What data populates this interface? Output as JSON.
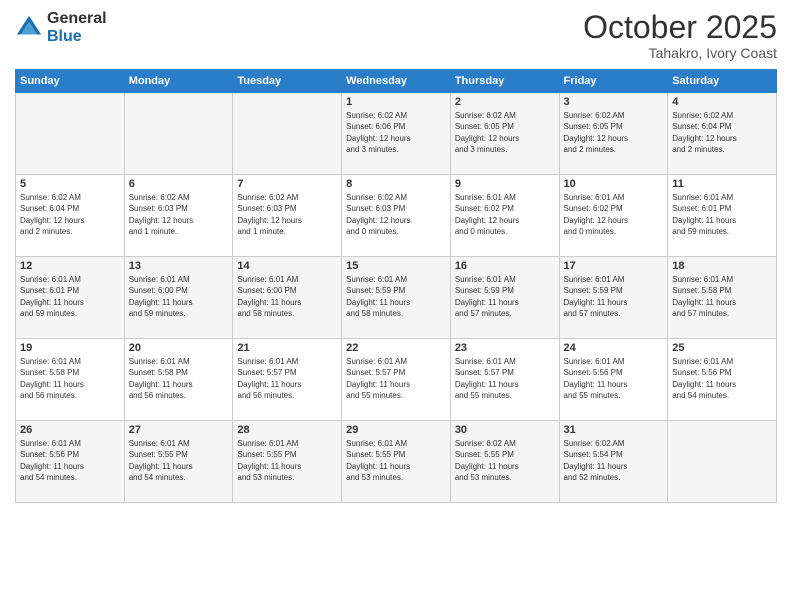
{
  "header": {
    "logo_general": "General",
    "logo_blue": "Blue",
    "month": "October 2025",
    "location": "Tahakro, Ivory Coast"
  },
  "weekdays": [
    "Sunday",
    "Monday",
    "Tuesday",
    "Wednesday",
    "Thursday",
    "Friday",
    "Saturday"
  ],
  "weeks": [
    [
      {
        "day": "",
        "detail": ""
      },
      {
        "day": "",
        "detail": ""
      },
      {
        "day": "",
        "detail": ""
      },
      {
        "day": "1",
        "detail": "Sunrise: 6:02 AM\nSunset: 6:06 PM\nDaylight: 12 hours\nand 3 minutes."
      },
      {
        "day": "2",
        "detail": "Sunrise: 6:02 AM\nSunset: 6:05 PM\nDaylight: 12 hours\nand 3 minutes."
      },
      {
        "day": "3",
        "detail": "Sunrise: 6:02 AM\nSunset: 6:05 PM\nDaylight: 12 hours\nand 2 minutes."
      },
      {
        "day": "4",
        "detail": "Sunrise: 6:02 AM\nSunset: 6:04 PM\nDaylight: 12 hours\nand 2 minutes."
      }
    ],
    [
      {
        "day": "5",
        "detail": "Sunrise: 6:02 AM\nSunset: 6:04 PM\nDaylight: 12 hours\nand 2 minutes."
      },
      {
        "day": "6",
        "detail": "Sunrise: 6:02 AM\nSunset: 6:03 PM\nDaylight: 12 hours\nand 1 minute."
      },
      {
        "day": "7",
        "detail": "Sunrise: 6:02 AM\nSunset: 6:03 PM\nDaylight: 12 hours\nand 1 minute."
      },
      {
        "day": "8",
        "detail": "Sunrise: 6:02 AM\nSunset: 6:03 PM\nDaylight: 12 hours\nand 0 minutes."
      },
      {
        "day": "9",
        "detail": "Sunrise: 6:01 AM\nSunset: 6:02 PM\nDaylight: 12 hours\nand 0 minutes."
      },
      {
        "day": "10",
        "detail": "Sunrise: 6:01 AM\nSunset: 6:02 PM\nDaylight: 12 hours\nand 0 minutes."
      },
      {
        "day": "11",
        "detail": "Sunrise: 6:01 AM\nSunset: 6:01 PM\nDaylight: 11 hours\nand 59 minutes."
      }
    ],
    [
      {
        "day": "12",
        "detail": "Sunrise: 6:01 AM\nSunset: 6:01 PM\nDaylight: 11 hours\nand 59 minutes."
      },
      {
        "day": "13",
        "detail": "Sunrise: 6:01 AM\nSunset: 6:00 PM\nDaylight: 11 hours\nand 59 minutes."
      },
      {
        "day": "14",
        "detail": "Sunrise: 6:01 AM\nSunset: 6:00 PM\nDaylight: 11 hours\nand 58 minutes."
      },
      {
        "day": "15",
        "detail": "Sunrise: 6:01 AM\nSunset: 5:59 PM\nDaylight: 11 hours\nand 58 minutes."
      },
      {
        "day": "16",
        "detail": "Sunrise: 6:01 AM\nSunset: 5:59 PM\nDaylight: 11 hours\nand 57 minutes."
      },
      {
        "day": "17",
        "detail": "Sunrise: 6:01 AM\nSunset: 5:59 PM\nDaylight: 11 hours\nand 57 minutes."
      },
      {
        "day": "18",
        "detail": "Sunrise: 6:01 AM\nSunset: 5:58 PM\nDaylight: 11 hours\nand 57 minutes."
      }
    ],
    [
      {
        "day": "19",
        "detail": "Sunrise: 6:01 AM\nSunset: 5:58 PM\nDaylight: 11 hours\nand 56 minutes."
      },
      {
        "day": "20",
        "detail": "Sunrise: 6:01 AM\nSunset: 5:58 PM\nDaylight: 11 hours\nand 56 minutes."
      },
      {
        "day": "21",
        "detail": "Sunrise: 6:01 AM\nSunset: 5:57 PM\nDaylight: 11 hours\nand 56 minutes."
      },
      {
        "day": "22",
        "detail": "Sunrise: 6:01 AM\nSunset: 5:57 PM\nDaylight: 11 hours\nand 55 minutes."
      },
      {
        "day": "23",
        "detail": "Sunrise: 6:01 AM\nSunset: 5:57 PM\nDaylight: 11 hours\nand 55 minutes."
      },
      {
        "day": "24",
        "detail": "Sunrise: 6:01 AM\nSunset: 5:56 PM\nDaylight: 11 hours\nand 55 minutes."
      },
      {
        "day": "25",
        "detail": "Sunrise: 6:01 AM\nSunset: 5:56 PM\nDaylight: 11 hours\nand 54 minutes."
      }
    ],
    [
      {
        "day": "26",
        "detail": "Sunrise: 6:01 AM\nSunset: 5:56 PM\nDaylight: 11 hours\nand 54 minutes."
      },
      {
        "day": "27",
        "detail": "Sunrise: 6:01 AM\nSunset: 5:55 PM\nDaylight: 11 hours\nand 54 minutes."
      },
      {
        "day": "28",
        "detail": "Sunrise: 6:01 AM\nSunset: 5:55 PM\nDaylight: 11 hours\nand 53 minutes."
      },
      {
        "day": "29",
        "detail": "Sunrise: 6:01 AM\nSunset: 5:55 PM\nDaylight: 11 hours\nand 53 minutes."
      },
      {
        "day": "30",
        "detail": "Sunrise: 6:02 AM\nSunset: 5:55 PM\nDaylight: 11 hours\nand 53 minutes."
      },
      {
        "day": "31",
        "detail": "Sunrise: 6:02 AM\nSunset: 5:54 PM\nDaylight: 11 hours\nand 52 minutes."
      },
      {
        "day": "",
        "detail": ""
      }
    ]
  ]
}
